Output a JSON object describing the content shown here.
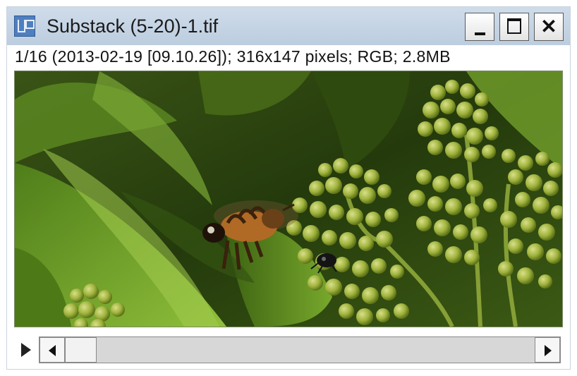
{
  "window": {
    "title": "Substack (5-20)-1.tif",
    "info_line": "1/16 (2013-02-19 [09.10.26]); 316x147 pixels; RGB; 2.8MB"
  },
  "image": {
    "subject": "bee-and-flower-buds",
    "palette": {
      "dark_green": "#2f4a12",
      "leaf_green": "#6f9a2a",
      "bud_green": "#a9b84a",
      "bee_orange": "#b06a25"
    }
  },
  "controls": {
    "play_icon": "play-icon",
    "slice_position": 1,
    "slice_count": 16
  }
}
